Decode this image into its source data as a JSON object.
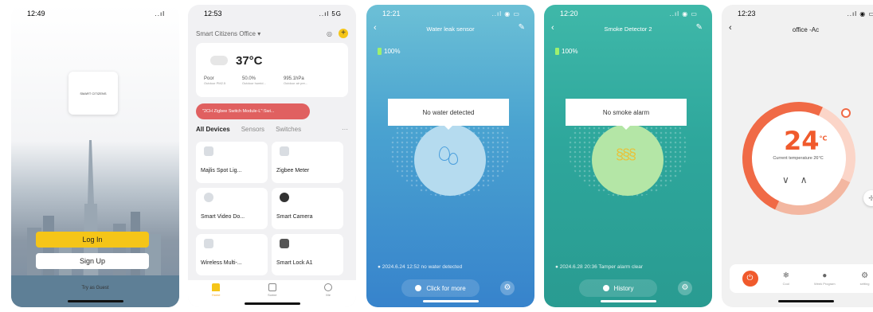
{
  "screen1": {
    "time": "12:49",
    "signal": "..ıl",
    "logo_text": "SMART CITIZENS",
    "login": "Log In",
    "signup": "Sign Up",
    "guest": "Try as Guest"
  },
  "screen2": {
    "time": "12:53",
    "signal": "..ıl 5G",
    "home_name": "Smart Citizens Office",
    "temp": "37°C",
    "stats": [
      {
        "value": "Poor",
        "label": "Outdoor PM2.5"
      },
      {
        "value": "50.0%",
        "label": "Outdoor humid..."
      },
      {
        "value": "995.1hPa",
        "label": "Outdoor air pre..."
      }
    ],
    "banner": "\"2CH Zigbee Switch Module-L\":Swi...",
    "tabs": [
      "All Devices",
      "Sensors",
      "Switches",
      "···"
    ],
    "devices": [
      "Majlis Spot Lig...",
      "Zigbee Meter",
      "Smart Video Do...",
      "Smart Camera",
      "Wireless Multi-...",
      "Smart Lock A1"
    ],
    "tabbar": [
      "Home",
      "Scene",
      "Me"
    ]
  },
  "screen3": {
    "time": "12:21",
    "title": "Water leak sensor",
    "battery": "100%",
    "popup": "No water detected",
    "log": "2024.6.24 12:52 no water detected",
    "action": "Click for more"
  },
  "screen4": {
    "time": "12:20",
    "title": "Smoke Detector 2",
    "battery": "100%",
    "popup": "No smoke alarm",
    "log": "2024.6.28 20:36 Tamper alarm clear",
    "action": "History"
  },
  "screen5": {
    "time": "12:23",
    "title": "office -Ac",
    "setpoint": "24",
    "unit": "°C",
    "current": "Current temperature 26°C",
    "bar": [
      "",
      "Cool",
      "Week Program",
      "setting"
    ]
  }
}
